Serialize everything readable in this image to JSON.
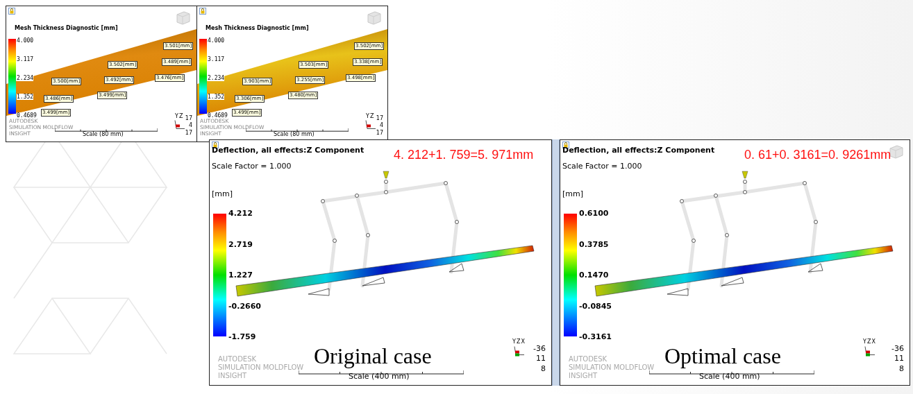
{
  "viewports": [
    {
      "kind": "thickness",
      "view_cube": true,
      "title": "Mesh Thickness Diagnostic [mm]",
      "legend": [
        "4.000",
        "3.117",
        "2.234",
        "1.352",
        "0.4689"
      ],
      "callouts": [
        "3.501[mm]",
        "3.489[mm]",
        "3.502[mm]",
        "3.500[mm]",
        "3.492[mm]",
        "3.476[mm]",
        "3.486[mm]",
        "3.499[mm]",
        "3.499[mm]"
      ],
      "brand": [
        "AUTODESK",
        "SIMULATION MOLDFLOW",
        "INSIGHT"
      ],
      "scale": "Scale (80 mm)",
      "triad_axes": [
        "Y",
        "Z"
      ],
      "triad_values": [
        "17",
        "4",
        "17"
      ]
    },
    {
      "kind": "thickness",
      "view_cube": true,
      "title": "Mesh Thickness Diagnostic [mm]",
      "legend": [
        "4.000",
        "3.117",
        "2.234",
        "1.352",
        "0.4689"
      ],
      "callouts": [
        "3.502[mm]",
        "3.338[mm]",
        "3.503[mm]",
        "3.903[mm]",
        "3.255[mm]",
        "3.498[mm]",
        "3.306[mm]",
        "3.480[mm]",
        "3.499[mm]"
      ],
      "brand": [
        "AUTODESK",
        "SIMULATION MOLDFLOW",
        "INSIGHT"
      ],
      "scale": "Scale (80 mm)",
      "triad_axes": [
        "Y",
        "Z"
      ],
      "triad_values": [
        "17",
        "4",
        "17"
      ]
    },
    {
      "kind": "deflection",
      "view_cube": false,
      "title": "Deflection, all effects:Z Component",
      "subtitle": "Scale Factor = 1.000",
      "unit": "[mm]",
      "legend": [
        "4.212",
        "2.719",
        "1.227",
        "-0.2660",
        "-1.759"
      ],
      "annotation": "4. 212+1. 759=5. 971mm",
      "caption": "Original case",
      "brand": [
        "AUTODESK",
        "SIMULATION MOLDFLOW",
        "INSIGHT"
      ],
      "scale": "Scale (400 mm)",
      "triad_axes": [
        "Y",
        "Z",
        "X"
      ],
      "triad_values": [
        "-36",
        "11",
        "8"
      ]
    },
    {
      "kind": "deflection",
      "view_cube": true,
      "title": "Deflection, all effects:Z Component",
      "subtitle": "Scale Factor = 1.000",
      "unit": "[mm]",
      "legend": [
        "0.6100",
        "0.3785",
        "0.1470",
        "-0.0845",
        "-0.3161"
      ],
      "annotation": "0. 61+0. 3161=0. 9261mm",
      "caption": "Optimal case",
      "brand": [
        "AUTODESK",
        "SIMULATION MOLDFLOW",
        "INSIGHT"
      ],
      "scale": "Scale (400 mm)",
      "triad_axes": [
        "Y",
        "Z",
        "X"
      ],
      "triad_values": [
        "-36",
        "11",
        "8"
      ]
    }
  ]
}
